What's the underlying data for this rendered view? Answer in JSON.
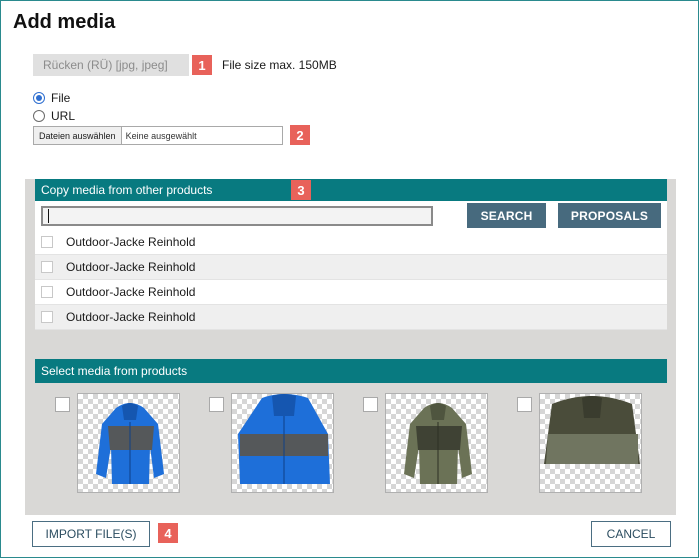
{
  "dialog": {
    "title": "Add media"
  },
  "badges": [
    "1",
    "2",
    "3",
    "4"
  ],
  "upload": {
    "type_select_value": "Rücken (RÜ)   [jpg, jpeg]",
    "file_size_note": "File size max. 150MB",
    "source_options": [
      {
        "label": "File",
        "checked": true
      },
      {
        "label": "URL",
        "checked": false
      }
    ],
    "file_button_label": "Dateien auswählen",
    "file_status": "Keine ausgewählt"
  },
  "copy_section": {
    "header": "Copy media from other products",
    "search_value": "",
    "search_button": "SEARCH",
    "proposals_button": "PROPOSALS",
    "products": [
      "Outdoor-Jacke Reinhold",
      "Outdoor-Jacke Reinhold",
      "Outdoor-Jacke Reinhold",
      "Outdoor-Jacke Reinhold"
    ]
  },
  "select_section": {
    "header": "Select media from products",
    "thumbnails": [
      {
        "icon": "jacket-blue-front-thumbnail",
        "color": "#1e6fd9"
      },
      {
        "icon": "jacket-blue-closeup-thumbnail",
        "color": "#1e6fd9"
      },
      {
        "icon": "jacket-olive-front-thumbnail",
        "color": "#5c6148"
      },
      {
        "icon": "jacket-olive-closeup-thumbnail",
        "color": "#5c6148"
      }
    ]
  },
  "footer": {
    "import_button": "IMPORT FILE(S)",
    "cancel_button": "CANCEL"
  },
  "colors": {
    "header_bg": "#087a80",
    "button_bg": "#476a7e",
    "badge_bg": "#e8625a"
  }
}
